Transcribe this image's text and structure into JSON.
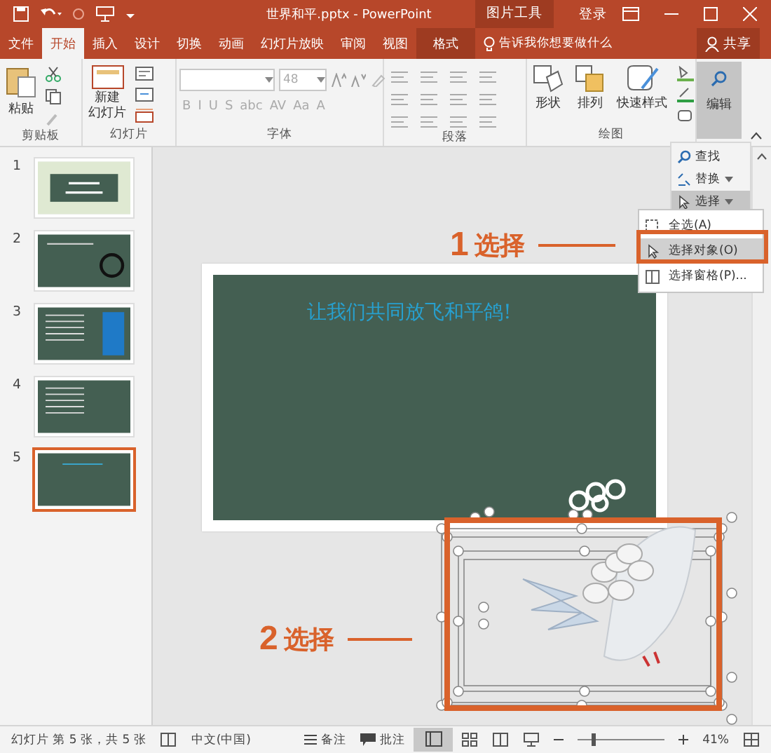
{
  "title_bar": {
    "title": "世界和平.pptx  -  PowerPoint",
    "context_label": "图片工具",
    "sign_in": "登录"
  },
  "tabs": [
    {
      "label": "文件",
      "selected": false,
      "kind": "normal"
    },
    {
      "label": "开始",
      "selected": true,
      "kind": "normal"
    },
    {
      "label": "插入",
      "selected": false,
      "kind": "normal"
    },
    {
      "label": "设计",
      "selected": false,
      "kind": "normal"
    },
    {
      "label": "切换",
      "selected": false,
      "kind": "normal"
    },
    {
      "label": "动画",
      "selected": false,
      "kind": "normal"
    },
    {
      "label": "幻灯片放映",
      "selected": false,
      "kind": "normal"
    },
    {
      "label": "审阅",
      "selected": false,
      "kind": "normal"
    },
    {
      "label": "视图",
      "selected": false,
      "kind": "normal"
    },
    {
      "label": "格式",
      "selected": false,
      "kind": "context"
    }
  ],
  "tell_me": {
    "placeholder": "告诉我你想要做什么"
  },
  "share": "共享",
  "ribbon": {
    "clipboard": {
      "label": "剪贴板",
      "paste": "粘贴"
    },
    "slides": {
      "label": "幻灯片",
      "new_slide": [
        "新建",
        "幻灯片"
      ]
    },
    "font": {
      "label": "字体",
      "font_size": "48",
      "format_buttons": [
        "B",
        "I",
        "U",
        "S",
        "abc",
        "AV",
        "Aa",
        "A"
      ]
    },
    "paragraph": {
      "label": "段落"
    },
    "drawing": {
      "label": "绘图",
      "buttons": [
        "形状",
        "排列",
        "快速样式"
      ]
    },
    "editing": {
      "label": "编辑",
      "pressed": true
    }
  },
  "editing_menu": [
    {
      "label": "查找",
      "kind": "find",
      "selected": false
    },
    {
      "label": "替换",
      "kind": "replace",
      "selected": false
    },
    {
      "label": "选择",
      "kind": "select",
      "selected": true
    }
  ],
  "select_menu": [
    {
      "label": "全选(A)",
      "selected": false
    },
    {
      "label": "选择对象(O)",
      "selected": true
    },
    {
      "label": "选择窗格(P)...",
      "selected": false
    }
  ],
  "slides": [
    {
      "number": "1",
      "selected": false,
      "kind": "title"
    },
    {
      "number": "2",
      "selected": false,
      "kind": "peace"
    },
    {
      "number": "3",
      "selected": false,
      "kind": "hand"
    },
    {
      "number": "4",
      "selected": false,
      "kind": "text"
    },
    {
      "number": "5",
      "selected": true,
      "kind": "dove"
    }
  ],
  "slide": {
    "title": "让我们共同放飞和平鸽!"
  },
  "callouts": [
    {
      "number": "1",
      "label": "选择"
    },
    {
      "number": "2",
      "label": "选择"
    }
  ],
  "status_bar": {
    "slide_info": "幻灯片 第 5 张，共 5 张",
    "language": "中文(中国)",
    "notes": "备注",
    "comments": "批注",
    "zoom_slider": {
      "level": 0.17
    },
    "zoom": "41%"
  }
}
